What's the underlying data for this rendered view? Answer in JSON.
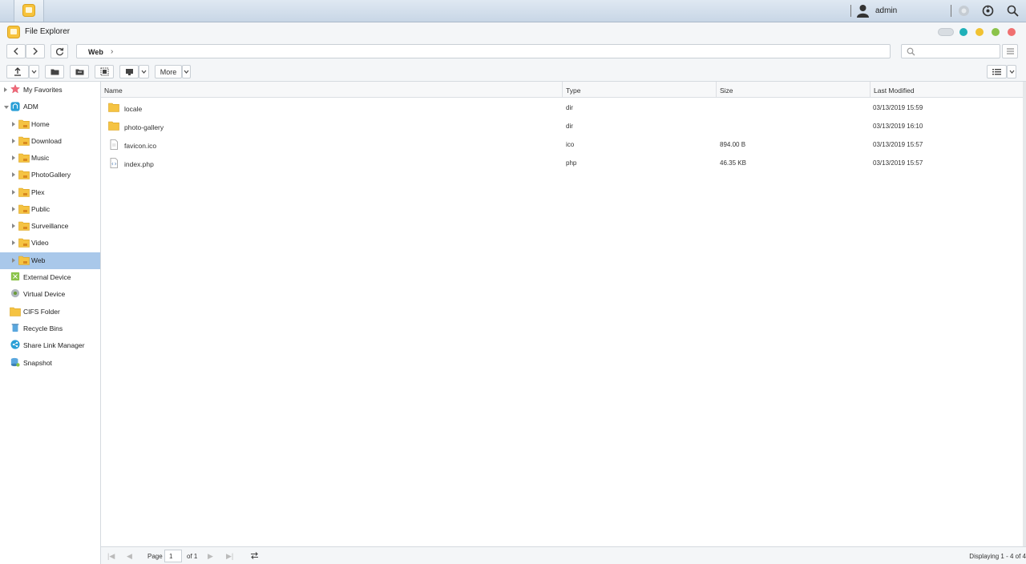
{
  "system_bar": {
    "username": "admin"
  },
  "window": {
    "title": "File Explorer"
  },
  "navigation": {
    "path_segment": "Web",
    "path_arrow": "›",
    "search_placeholder": ""
  },
  "toolbar": {
    "more_label": "More"
  },
  "sidebar": {
    "favorites": "My Favorites",
    "root": "ADM",
    "folders": [
      "Home",
      "Download",
      "Music",
      "PhotoGallery",
      "Plex",
      "Public",
      "Surveillance",
      "Video",
      "Web"
    ],
    "selected": "Web",
    "bottom_items": [
      "External Device",
      "Virtual Device",
      "CIFS Folder",
      "Recycle Bins",
      "Share Link Manager",
      "Snapshot"
    ]
  },
  "file_list": {
    "columns": [
      "Name",
      "Type",
      "Size",
      "Last Modified"
    ],
    "rows": [
      {
        "name": "locale",
        "type": "dir",
        "size": "",
        "modified": "03/13/2019 15:59",
        "kind": "folder"
      },
      {
        "name": "photo-gallery",
        "type": "dir",
        "size": "",
        "modified": "03/13/2019 16:10",
        "kind": "folder"
      },
      {
        "name": "favicon.ico",
        "type": "ico",
        "size": "894.00 B",
        "modified": "03/13/2019 15:57",
        "kind": "file"
      },
      {
        "name": "index.php",
        "type": "php",
        "size": "46.35 KB",
        "modified": "03/13/2019 15:57",
        "kind": "code"
      }
    ]
  },
  "pagination": {
    "page_label": "Page",
    "page_value": "1",
    "of_label": "of 1",
    "display_text": "Displaying 1 - 4 of 4"
  },
  "colors": {
    "accent_selected": "#a9c8ea",
    "folder_yellow": "#f5c342",
    "ctl_teal": "#1fb0b8",
    "ctl_yellow": "#f1c232",
    "ctl_green": "#8bc34a",
    "ctl_red": "#f07070"
  }
}
